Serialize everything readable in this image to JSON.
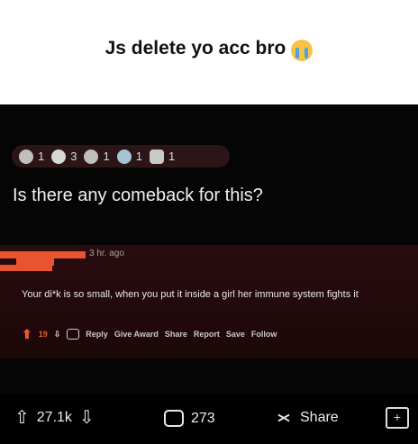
{
  "caption": {
    "text": "Js delete yo acc bro",
    "emoji": "crying-face-emoji"
  },
  "awards": [
    {
      "icon": "silver-award-icon",
      "count": "1"
    },
    {
      "icon": "helpful-award-icon",
      "count": "3"
    },
    {
      "icon": "wholesome-award-icon",
      "count": "1"
    },
    {
      "icon": "bird-award-icon",
      "count": "1"
    },
    {
      "icon": "bunny-award-icon",
      "count": "1"
    }
  ],
  "post": {
    "title": "Is there any comeback for this?"
  },
  "comment": {
    "time": "3 hr. ago",
    "body": "Your di*k is so small, when you put it inside a girl her immune system fights it",
    "score": "19",
    "actions": [
      "Reply",
      "Give Award",
      "Share",
      "Report",
      "Save",
      "Follow"
    ]
  },
  "bottom": {
    "votes": "27.1k",
    "comments": "273",
    "share": "Share"
  }
}
